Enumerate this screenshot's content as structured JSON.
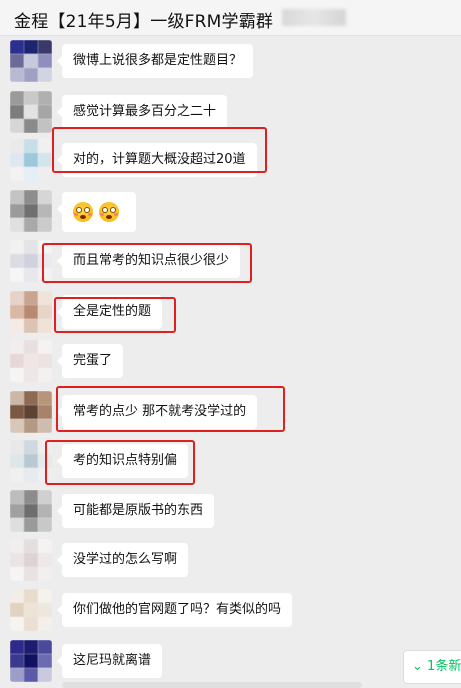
{
  "header": {
    "title": "金程【21年5月】一级FRM学霸群"
  },
  "messages": [
    {
      "text": "微博上说很多都是定性题目？",
      "highlighted": false,
      "avatar": [
        "#2b2f8f",
        "#1d2470",
        "#3a3a6a",
        "#6b6b9a",
        "#c7c9dd",
        "#8e8fbf",
        "#b8bad2",
        "#9fa1c4",
        "#d2d3e3"
      ]
    },
    {
      "text": "感觉计算最多百分之二十",
      "highlighted": false,
      "avatar": [
        "#9a9a9a",
        "#c9c9c9",
        "#b0b0b0",
        "#7d7d7d",
        "#e3e3e3",
        "#a6a6a6",
        "#d6d6d6",
        "#8a8a8a",
        "#c2c2c2"
      ]
    },
    {
      "text": "对的，计算题大概没超过20道",
      "highlighted": true,
      "avatar": [
        "#eaeaea",
        "#c8dfea",
        "#f0f0f0",
        "#dfe8ee",
        "#9cc8dc",
        "#d3e4ec",
        "#f2f2f2",
        "#e5eef2",
        "#eeeeee"
      ]
    },
    {
      "text": "",
      "emoji_count": 2,
      "highlighted": false,
      "avatar": [
        "#c4c4c4",
        "#8d8d8d",
        "#d6d6d6",
        "#9b9b9b",
        "#6f6f6f",
        "#b7b7b7",
        "#e0e0e0",
        "#a9a9a9",
        "#cbcbcb"
      ]
    },
    {
      "text": "而且常考的知识点很少很少",
      "highlighted": true,
      "avatar": [
        "#f1f1f1",
        "#e3e3e8",
        "#f4f4f4",
        "#dcdce4",
        "#cfd1de",
        "#e9e9ee",
        "#f6f6f6",
        "#e7e7ec",
        "#f2f2f2"
      ]
    },
    {
      "text": "全是定性的题",
      "highlighted": true,
      "avatar": [
        "#e6d2c6",
        "#c9a48e",
        "#efe3da",
        "#d9b8a4",
        "#b88a72",
        "#e9d5c8",
        "#f3ebe4",
        "#dcc3b3",
        "#efe2d8"
      ]
    },
    {
      "text": "完蛋了",
      "highlighted": false,
      "avatar": [
        "#f3eeee",
        "#eadfdf",
        "#f6f2f2",
        "#e7d8d8",
        "#f0e6e6",
        "#ece2e2",
        "#f7f4f4",
        "#efe6e6",
        "#f5f0f0"
      ]
    },
    {
      "text": "常考的点少 那不就考没学过的",
      "highlighted": true,
      "avatar": [
        "#cdb8a8",
        "#8f6a52",
        "#b89478",
        "#7a5842",
        "#5e4333",
        "#a8826a",
        "#d9c8ba",
        "#b49984",
        "#cfbcae"
      ]
    },
    {
      "text": "考的知识点特别偏",
      "highlighted": true,
      "avatar": [
        "#e8e8e8",
        "#cfd8df",
        "#eeeeee",
        "#dfe6ea",
        "#b8c9d4",
        "#e3e9ed",
        "#f0f0f0",
        "#e6ebee",
        "#efefef"
      ]
    },
    {
      "text": "可能都是原版书的东西",
      "highlighted": false,
      "avatar": [
        "#bdbdbd",
        "#8c8c8c",
        "#d0d0d0",
        "#a0a0a0",
        "#6e6e6e",
        "#b3b3b3",
        "#dedede",
        "#9a9a9a",
        "#c8c8c8"
      ]
    },
    {
      "text": "没学过的怎么写啊",
      "highlighted": false,
      "avatar": [
        "#f0eeee",
        "#e4dede",
        "#f4f2f2",
        "#ebe4e4",
        "#ddd3d3",
        "#eee8e8",
        "#f6f4f4",
        "#e8e2e2",
        "#f2efef"
      ]
    },
    {
      "text": "你们做他的官网题了吗？有类似的吗",
      "highlighted": false,
      "avatar": [
        "#f2ede6",
        "#e8dccd",
        "#f5f1ec",
        "#e2d3c1",
        "#ede3d6",
        "#efe6dc",
        "#f7f4ef",
        "#eadfd2",
        "#f4efe9"
      ]
    },
    {
      "text": "这尼玛就离谱",
      "highlighted": false,
      "avatar": [
        "#2c2a8a",
        "#1e1c6e",
        "#4b4a9a",
        "#3a3990",
        "#121060",
        "#6b6bb0",
        "#9d9dc9",
        "#5a5aa8",
        "#c9c9e0"
      ]
    }
  ],
  "toast": {
    "label": "1条新"
  },
  "colors": {
    "highlight": "#e02020",
    "accent": "#07c160",
    "background": "#ededed"
  }
}
